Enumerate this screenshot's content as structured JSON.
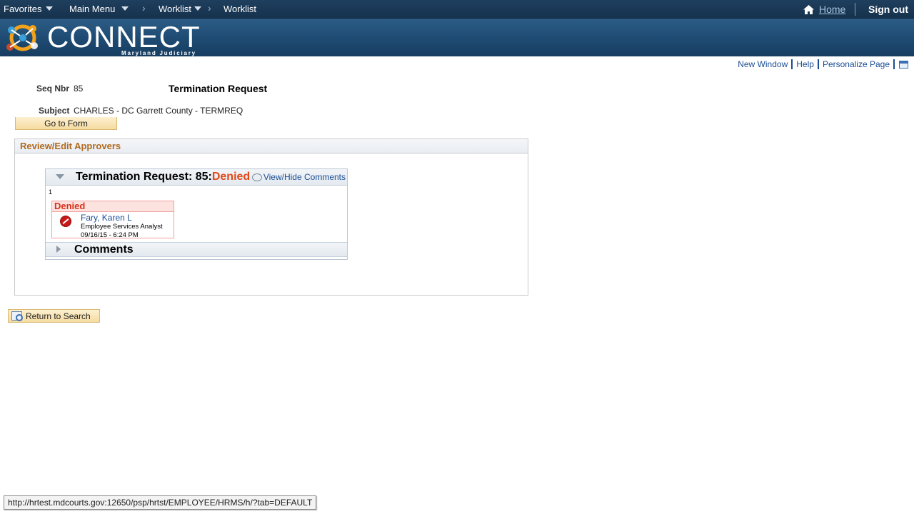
{
  "topnav": {
    "favorites": "Favorites",
    "main_menu": "Main Menu",
    "worklist_menu": "Worklist",
    "worklist_crumb": "Worklist",
    "separator": "›",
    "home": "Home",
    "signout": "Sign out"
  },
  "banner": {
    "logo_text": "CONNECT",
    "logo_sub": "Maryland Judiciary"
  },
  "pagelinks": {
    "new_window": "New Window",
    "help": "Help",
    "personalize": "Personalize Page"
  },
  "header": {
    "seq_label": "Seq Nbr",
    "seq_value": "85",
    "title": "Termination Request",
    "subject_label": "Subject",
    "subject_value": "CHARLES - DC Garrett County - TERMREQ",
    "go_to_form": "Go to Form"
  },
  "group": {
    "title": "Review/Edit Approvers",
    "approval": {
      "title_prefix": "Termination Request: 85:",
      "status": "Denied",
      "view_hide": "View/Hide Comments",
      "step_number": "1",
      "card": {
        "status": "Denied",
        "name": "Fary, Karen L",
        "role": "Employee Services Analyst",
        "date": "09/16/15 - 6:24 PM"
      },
      "comments_label": "Comments"
    }
  },
  "return_to_search": "Return to Search",
  "statusbar_url": "http://hrtest.mdcourts.gov:12650/psp/hrtst/EMPLOYEE/HRMS/h/?tab=DEFAULT",
  "colors": {
    "nav_bg": "#1f3f5e",
    "banner_bg": "#1e4a72",
    "link": "#1b4d94",
    "denied": "#e04a1a",
    "group_title": "#b06a1c"
  }
}
